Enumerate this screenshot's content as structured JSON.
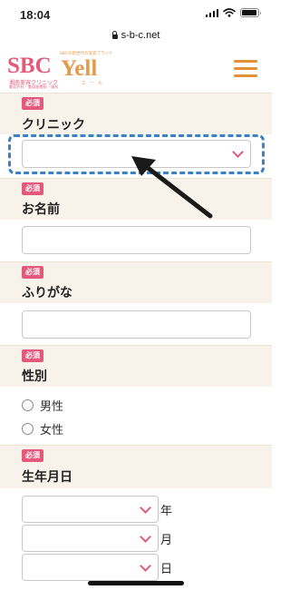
{
  "status_bar": {
    "time": "18:04"
  },
  "browser": {
    "url": "s-b-c.net"
  },
  "header": {
    "logo_sbc": "SBC",
    "logo_sbc_sub": "湘南美容クリニック",
    "logo_sbc_sub2": "美容外科・美容皮膚科・歯科",
    "logo_yell_tag": "SBCの新世代の美容ブランド",
    "logo_yell": "Yell",
    "logo_yell_kana": "エール"
  },
  "form": {
    "required_badge": "必須",
    "clinic": {
      "label": "クリニック",
      "selected": ""
    },
    "name": {
      "label": "お名前",
      "value": ""
    },
    "furigana": {
      "label": "ふりがな",
      "value": ""
    },
    "gender": {
      "label": "性別",
      "options": [
        "男性",
        "女性"
      ]
    },
    "birthdate": {
      "label": "生年月日",
      "units": [
        "年",
        "月",
        "日"
      ]
    }
  },
  "colors": {
    "accent_pink": "#e4587b",
    "accent_orange": "#e4923a",
    "section_bg": "#f8f3ea",
    "highlight_blue": "#3b82c4"
  },
  "icons": [
    "signal-icon",
    "wifi-icon",
    "battery-icon",
    "lock-icon",
    "hamburger-menu-icon",
    "chevron-down-icon",
    "pointer-arrow-icon"
  ]
}
